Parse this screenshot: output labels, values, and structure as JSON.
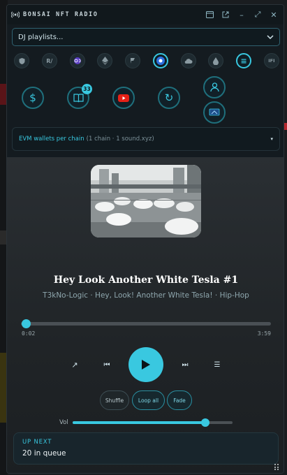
{
  "app": {
    "title": "BONSAI NFT RADIO"
  },
  "titlebar": {
    "icons": [
      "radio-icon",
      "window-icon",
      "external-link-icon",
      "minimize-icon",
      "expand-icon",
      "close-icon"
    ],
    "minimize_glyph": "–",
    "expand_glyph": "⤢",
    "close_glyph": "✕"
  },
  "playlist_select": {
    "value": "DJ playlists..."
  },
  "chains": {
    "items": [
      {
        "name": "shield-chain",
        "label": ""
      },
      {
        "name": "r-chain",
        "label": "R/"
      },
      {
        "name": "polygon-chain",
        "label": ""
      },
      {
        "name": "ethereum-chain",
        "label": ""
      },
      {
        "name": "flag-chain",
        "label": ""
      },
      {
        "name": "zora-chain",
        "label": "",
        "active": true
      },
      {
        "name": "cloud-chain",
        "label": ""
      },
      {
        "name": "drop-chain",
        "label": ""
      },
      {
        "name": "menu-chain",
        "label": "≡",
        "active": true
      },
      {
        "name": "ifi-chain",
        "label": "IFI"
      }
    ]
  },
  "actions": {
    "dollar_glyph": "$",
    "library_badge": "33",
    "refresh_glyph": "↻"
  },
  "wallet_filter": {
    "label": "EVM wallets per chain",
    "detail": "(1 chain · 1 sound.xyz)",
    "caret": "▾"
  },
  "now_playing": {
    "title": "Hey Look Another White Tesla #1",
    "subtitle": "T3kNo-Logic · Hey, Look! Another White Tesla! · Hip-Hop",
    "elapsed": "0:02",
    "duration": "3:59",
    "progress_fraction": 0.008
  },
  "transport": {
    "share_glyph": "↗",
    "prev_glyph": "⏮",
    "next_glyph": "⏭",
    "queue_glyph": "☰"
  },
  "modes": {
    "shuffle": "Shuffle",
    "loop": "Loop all",
    "fade": "Fade"
  },
  "volume": {
    "label": "Vol",
    "level": 0.83
  },
  "up_next": {
    "label": "UP NEXT",
    "value": "20 in queue"
  },
  "colors": {
    "accent": "#39c8e0",
    "window_bg": "#141b20"
  }
}
